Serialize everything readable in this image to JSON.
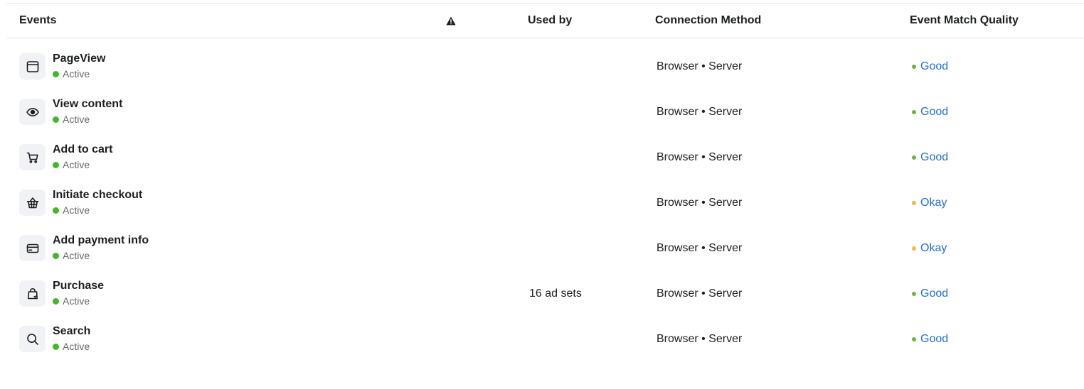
{
  "header": {
    "events": "Events",
    "warning_icon": "warning-triangle-icon",
    "used_by": "Used by",
    "connection_method": "Connection Method",
    "event_match_quality": "Event Match Quality"
  },
  "colors": {
    "active": "#42b72a",
    "good": "#6bb536",
    "okay": "#f5b93f",
    "link": "#216fdb"
  },
  "events": [
    {
      "name": "PageView",
      "icon": "browser-window-icon",
      "status": "Active",
      "used_by": "",
      "connection": "Browser • Server",
      "quality": "Good",
      "quality_color": "#6bb536"
    },
    {
      "name": "View content",
      "icon": "eye-icon",
      "status": "Active",
      "used_by": "",
      "connection": "Browser • Server",
      "quality": "Good",
      "quality_color": "#6bb536"
    },
    {
      "name": "Add to cart",
      "icon": "cart-icon",
      "status": "Active",
      "used_by": "",
      "connection": "Browser • Server",
      "quality": "Good",
      "quality_color": "#6bb536"
    },
    {
      "name": "Initiate checkout",
      "icon": "basket-icon",
      "status": "Active",
      "used_by": "",
      "connection": "Browser • Server",
      "quality": "Okay",
      "quality_color": "#f5b93f"
    },
    {
      "name": "Add payment info",
      "icon": "credit-card-icon",
      "status": "Active",
      "used_by": "",
      "connection": "Browser • Server",
      "quality": "Okay",
      "quality_color": "#f5b93f"
    },
    {
      "name": "Purchase",
      "icon": "shopping-bag-icon",
      "status": "Active",
      "used_by": "16 ad sets",
      "connection": "Browser • Server",
      "quality": "Good",
      "quality_color": "#6bb536"
    },
    {
      "name": "Search",
      "icon": "search-icon",
      "status": "Active",
      "used_by": "",
      "connection": "Browser • Server",
      "quality": "Good",
      "quality_color": "#6bb536"
    }
  ]
}
